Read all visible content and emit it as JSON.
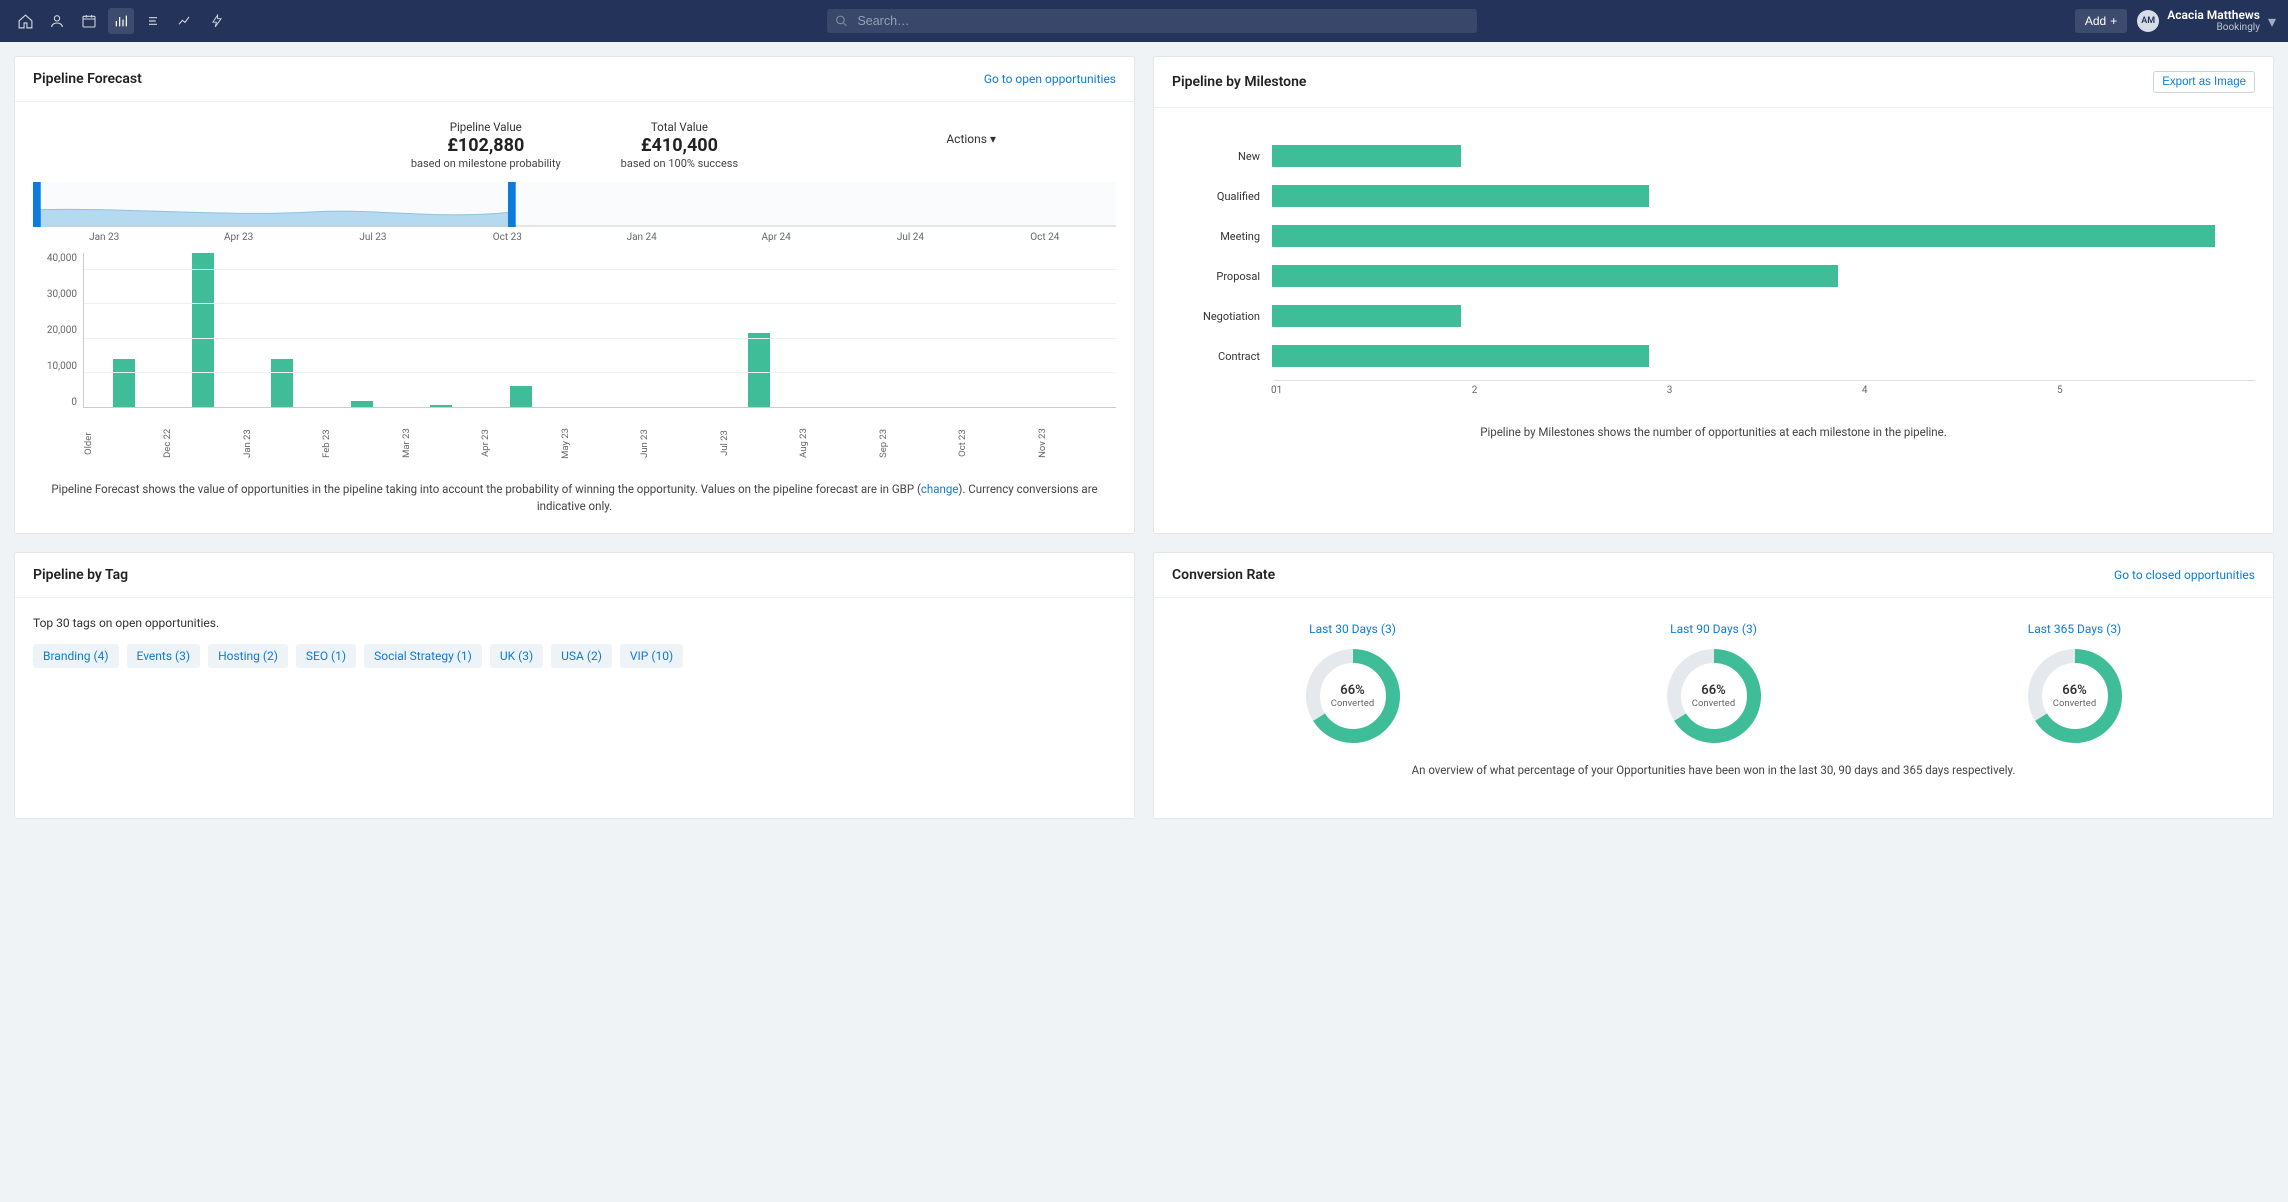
{
  "colors": {
    "navy": "#23335a",
    "teal": "#3ebd98",
    "link": "#0d7bdc"
  },
  "topbar": {
    "search_placeholder": "Search…",
    "add_label": "Add",
    "user": {
      "initials": "AM",
      "name": "Acacia Matthews",
      "org": "Bookingly"
    }
  },
  "cards": {
    "forecast": {
      "title": "Pipeline Forecast",
      "link": "Go to open opportunities",
      "kpi_pipeline": {
        "label": "Pipeline Value",
        "value": "£102,880",
        "sub": "based on milestone probability"
      },
      "kpi_total": {
        "label": "Total Value",
        "value": "£410,400",
        "sub": "based on 100% success"
      },
      "actions_label": "Actions",
      "desc_prefix": "Pipeline Forecast shows the value of opportunities in the pipeline taking into account the probability of winning the opportunity. Values on the pipeline forecast are in GBP (",
      "desc_change": "change",
      "desc_suffix": "). Currency conversions are indicative only."
    },
    "milestone": {
      "title": "Pipeline by Milestone",
      "export": "Export as Image",
      "desc": "Pipeline by Milestones shows the number of opportunities at each milestone in the pipeline."
    },
    "tags": {
      "title": "Pipeline by Tag",
      "intro": "Top 30 tags on open opportunities.",
      "items": [
        "Branding (4)",
        "Events (3)",
        "Hosting (2)",
        "SEO (1)",
        "Social Strategy (1)",
        "UK (3)",
        "USA (2)",
        "VIP (10)"
      ]
    },
    "conversion": {
      "title": "Conversion Rate",
      "link": "Go to closed opportunities",
      "converted_label": "Converted",
      "desc": "An overview of what percentage of your Opportunities have been won in the last 30, 90 days and 365 days respectively.",
      "periods": [
        {
          "label": "Last 30 Days (3)",
          "pct": 66
        },
        {
          "label": "Last 90 Days (3)",
          "pct": 66
        },
        {
          "label": "Last 365 Days (3)",
          "pct": 66
        }
      ]
    }
  },
  "chart_data": [
    {
      "id": "forecast_mini",
      "type": "area",
      "categories": [
        "Jan 23",
        "Apr 23",
        "Jul 23",
        "Oct 23",
        "Jan 24",
        "Apr 24",
        "Jul 24",
        "Oct 24"
      ],
      "selection_start": "Jan 23",
      "selection_end": "Nov 23"
    },
    {
      "id": "forecast_bars",
      "type": "bar",
      "ylabel": "",
      "ylim": [
        0,
        45000
      ],
      "y_ticks": [
        0,
        10000,
        20000,
        30000,
        40000
      ],
      "categories": [
        "Older",
        "Dec 22",
        "Jan 23",
        "Feb 23",
        "Mar 23",
        "Apr 23",
        "May 23",
        "Jun 23",
        "Jul 23",
        "Aug 23",
        "Sep 23",
        "Oct 23",
        "Nov 23"
      ],
      "values": [
        14000,
        45000,
        14000,
        1800,
        700,
        6000,
        0,
        0,
        21500,
        0,
        0,
        0,
        0
      ]
    },
    {
      "id": "milestone_bars",
      "type": "bar",
      "orientation": "horizontal",
      "xlim": [
        0,
        5
      ],
      "x_ticks": [
        0,
        1,
        2,
        3,
        4,
        5
      ],
      "categories": [
        "New",
        "Qualified",
        "Meeting",
        "Proposal",
        "Negotiation",
        "Contract"
      ],
      "values": [
        1,
        2,
        5,
        3,
        1,
        2
      ]
    }
  ]
}
